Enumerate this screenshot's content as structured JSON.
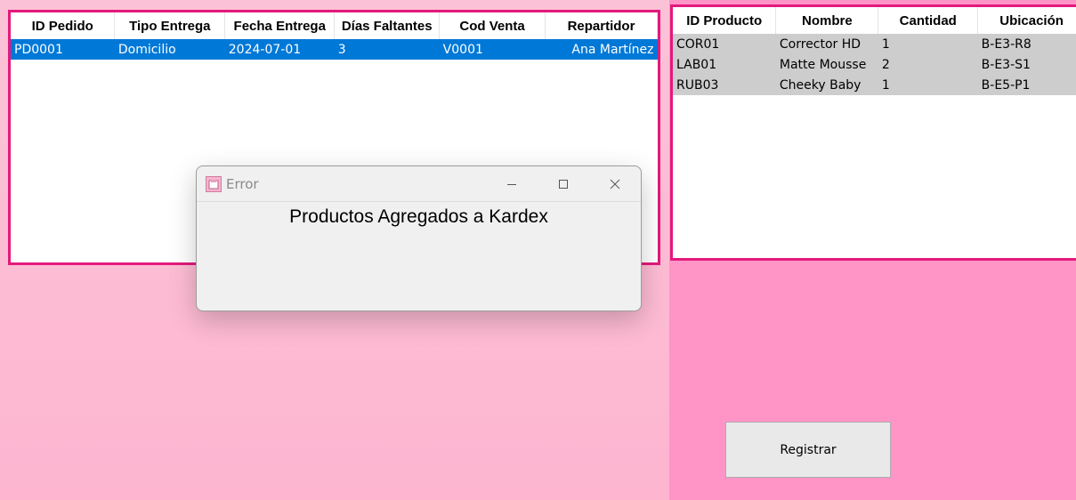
{
  "orders_table": {
    "columns": [
      "ID Pedido",
      "Tipo Entrega",
      "Fecha Entrega",
      "Días Faltantes",
      "Cod Venta",
      "Repartidor"
    ],
    "rows": [
      [
        "PD0001",
        "Domicilio",
        "2024-07-01",
        "3",
        "V0001",
        "Ana Martínez"
      ]
    ]
  },
  "products_table": {
    "columns": [
      "ID Producto",
      "Nombre",
      "Cantidad",
      "Ubicación"
    ],
    "rows": [
      [
        "COR01",
        "Corrector HD",
        "1",
        "B-E3-R8"
      ],
      [
        "LAB01",
        "Matte Mousse",
        "2",
        "B-E3-S1"
      ],
      [
        "RUB03",
        "Cheeky Baby",
        "1",
        "B-E5-P1"
      ]
    ]
  },
  "dialog": {
    "title": "Error",
    "message": "Productos Agregados a Kardex",
    "app_icon": "app-icon",
    "controls": [
      "minimize-icon",
      "maximize-icon",
      "close-icon"
    ]
  },
  "register_button": {
    "label": "Registrar"
  },
  "colors": {
    "accent_border": "#e3197c",
    "selection": "#0078d7",
    "right_background": "#ff94c6",
    "row_gray": "#cdcdcd"
  }
}
